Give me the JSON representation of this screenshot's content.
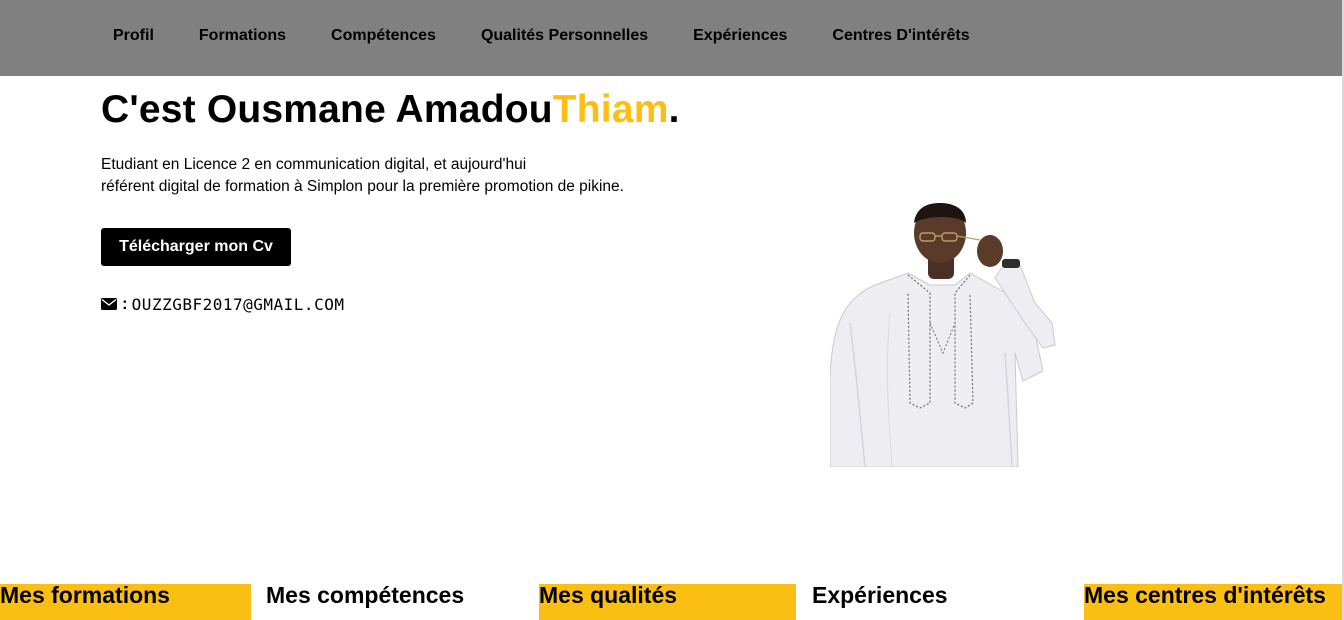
{
  "nav": {
    "items": [
      "Profil",
      "Formations",
      "Compétences",
      "Qualités Personnelles",
      "Expériences",
      "Centres D'intérêts"
    ]
  },
  "hero": {
    "title_main": "C'est Ousmane Amadou",
    "title_accent": "Thiam",
    "title_end": ".",
    "intro_line1": "Etudiant en Licence 2 en communication digital, et aujourd'hui",
    "intro_line2": "référent digital de formation à Simplon pour la première promotion de pikine.",
    "cv_button": "Télécharger mon Cv",
    "email_separator": ":",
    "email": "ouzzgbf2017@gmail.com"
  },
  "sections": {
    "formations": "Mes formations",
    "competences": "Mes compétences",
    "qualites": "Mes qualités",
    "experiences": "Expériences",
    "interets": "Mes centres d'intérêts"
  },
  "colors": {
    "accent": "#fbbf13",
    "navbar": "#808080",
    "button": "#000000"
  },
  "icons": {
    "email": "envelope-icon"
  }
}
